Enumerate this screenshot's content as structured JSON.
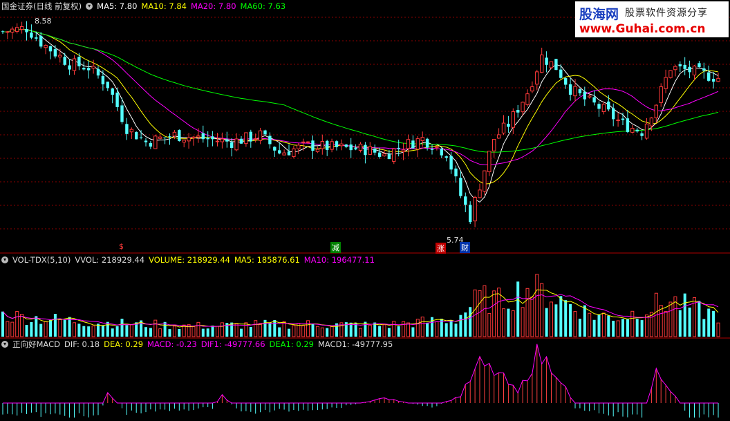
{
  "colors": {
    "up": "#ff3a3a",
    "down": "#54ffff",
    "ma5": "#ffffff",
    "ma10": "#ffff00",
    "ma20": "#ff00ff",
    "ma60": "#00ff00",
    "grid": "#8b0000",
    "divider": "#b00000"
  },
  "price_panel": {
    "title": "国金证券(日线 前复权)",
    "ma5": "MA5: 7.80",
    "ma10": "MA10: 7.84",
    "ma20": "MA20: 7.80",
    "ma60": "MA60: 7.63",
    "high_label": "8.58",
    "low_label": "5.74",
    "markers": [
      "$",
      "减",
      "涨",
      "财"
    ]
  },
  "volume_panel": {
    "name": "VOL-TDX(5,10)",
    "vvol": "VVOL: 218929.44",
    "volume": "VOLUME: 218929.44",
    "ma5": "MA5: 185876.61",
    "ma10": "MA10: 196477.11"
  },
  "macd_panel": {
    "name": "正向好MACD",
    "dif": "DIF: 0.18",
    "dea": "DEA: 0.29",
    "macd": "MACD: -0.23",
    "dif1": "DIF1: -49777.66",
    "dea1": "DEA1: 0.29",
    "macd1": "MACD1: -49777.95"
  },
  "logo": {
    "brand": "股海网",
    "slogan": "股票软件资源分享",
    "url": "www.Guhai.com.cn"
  },
  "chart_data": {
    "type": "candlestick",
    "ylim": [
      5.5,
      8.7
    ],
    "high": 8.58,
    "low": 5.74,
    "anchors": [
      [
        0,
        8.45
      ],
      [
        5,
        8.5
      ],
      [
        8,
        8.3
      ],
      [
        14,
        8.0
      ],
      [
        18,
        7.95
      ],
      [
        22,
        7.7
      ],
      [
        26,
        7.1
      ],
      [
        30,
        6.9
      ],
      [
        36,
        7.0
      ],
      [
        42,
        6.95
      ],
      [
        48,
        6.9
      ],
      [
        54,
        7.0
      ],
      [
        58,
        6.75
      ],
      [
        64,
        6.85
      ],
      [
        70,
        6.82
      ],
      [
        76,
        6.8
      ],
      [
        80,
        6.72
      ],
      [
        84,
        6.85
      ],
      [
        88,
        6.95
      ],
      [
        93,
        6.75
      ],
      [
        96,
        6.15
      ],
      [
        98,
        5.85
      ],
      [
        100,
        6.3
      ],
      [
        103,
        6.95
      ],
      [
        106,
        7.15
      ],
      [
        110,
        7.6
      ],
      [
        113,
        8.1
      ],
      [
        116,
        7.95
      ],
      [
        119,
        7.65
      ],
      [
        122,
        7.5
      ],
      [
        126,
        7.35
      ],
      [
        130,
        7.15
      ],
      [
        134,
        7.05
      ],
      [
        137,
        7.45
      ],
      [
        140,
        7.95
      ],
      [
        144,
        7.9
      ],
      [
        150,
        7.8
      ]
    ],
    "volume_anchors": [
      [
        0,
        0.3
      ],
      [
        20,
        0.2
      ],
      [
        40,
        0.15
      ],
      [
        60,
        0.18
      ],
      [
        80,
        0.16
      ],
      [
        95,
        0.25
      ],
      [
        100,
        0.55
      ],
      [
        104,
        0.5
      ],
      [
        110,
        0.7
      ],
      [
        114,
        0.6
      ],
      [
        118,
        0.5
      ],
      [
        124,
        0.3
      ],
      [
        130,
        0.28
      ],
      [
        137,
        0.45
      ],
      [
        140,
        0.5
      ],
      [
        150,
        0.3
      ]
    ],
    "macd_anchors": [
      [
        0,
        -0.2
      ],
      [
        20,
        -0.3
      ],
      [
        22,
        0.2
      ],
      [
        26,
        -0.2
      ],
      [
        44,
        -0.1
      ],
      [
        46,
        0.15
      ],
      [
        50,
        -0.2
      ],
      [
        70,
        -0.1
      ],
      [
        80,
        0.1
      ],
      [
        90,
        -0.1
      ],
      [
        96,
        0.15
      ],
      [
        100,
        0.8
      ],
      [
        104,
        0.6
      ],
      [
        108,
        0.2
      ],
      [
        112,
        1.0
      ],
      [
        116,
        0.7
      ],
      [
        120,
        -0.1
      ],
      [
        126,
        -0.2
      ],
      [
        134,
        -0.3
      ],
      [
        137,
        0.6
      ],
      [
        140,
        0.3
      ],
      [
        144,
        -0.3
      ],
      [
        150,
        -0.3
      ]
    ]
  }
}
